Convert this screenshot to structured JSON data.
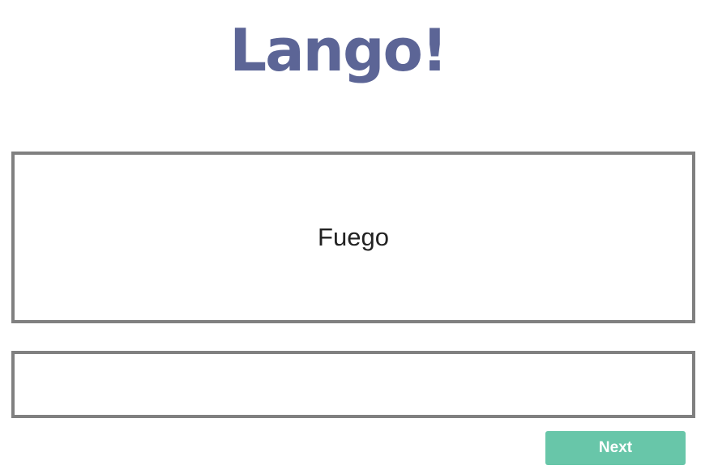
{
  "app": {
    "logo_text": "Lango!",
    "logo_color": "#5c6596"
  },
  "card": {
    "prompt_word": "Fuego",
    "border_color": "#808080"
  },
  "answer": {
    "value": "",
    "placeholder": ""
  },
  "actions": {
    "next_label": "Next",
    "next_color": "#68c6a9"
  }
}
